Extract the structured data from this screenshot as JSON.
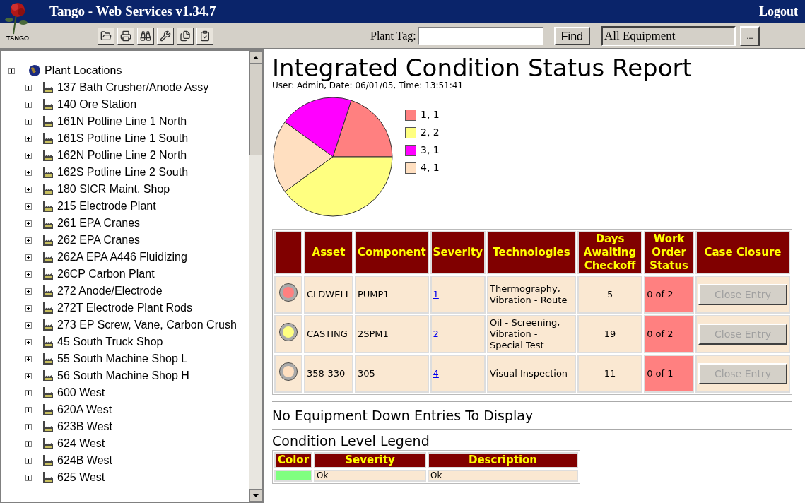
{
  "window": {
    "title": "Tango - Web Services v1.34.7",
    "logout": "Logout"
  },
  "logo": {
    "text": "TANGO"
  },
  "toolbar": {
    "plant_tag_label": "Plant Tag:",
    "find_button": "Find",
    "equipment_field": "All Equipment",
    "browse_button": "..."
  },
  "tree": {
    "root": {
      "label": "Plant Locations",
      "expanded": false,
      "children": [
        {
          "label": "137 Bath Crusher/Anode Assy",
          "expanded": false
        },
        {
          "label": "140 Ore Station",
          "expanded": false
        },
        {
          "label": "161N Potline Line 1 North",
          "expanded": false
        },
        {
          "label": "161S Potline Line 1 South",
          "expanded": false
        },
        {
          "label": "162N Potline Line 2 North",
          "expanded": false
        },
        {
          "label": "162S Potline Line 2 South",
          "expanded": false
        },
        {
          "label": "180 SICR Maint. Shop",
          "expanded": false
        },
        {
          "label": "215 Electrode Plant",
          "expanded": false
        },
        {
          "label": "261 EPA Cranes",
          "expanded": false
        },
        {
          "label": "262 EPA Cranes",
          "expanded": false
        },
        {
          "label": "262A EPA A446 Fluidizing",
          "expanded": false
        },
        {
          "label": "26CP Carbon Plant",
          "expanded": false
        },
        {
          "label": "272 Anode/Electrode",
          "expanded": false
        },
        {
          "label": "272T Electrode Plant Rods",
          "expanded": false
        },
        {
          "label": "273 EP Screw, Vane, Carbon Crush",
          "expanded": false
        },
        {
          "label": "45 South Truck Shop",
          "expanded": false
        },
        {
          "label": "55 South Machine Shop L",
          "expanded": false
        },
        {
          "label": "56 South Machine Shop H",
          "expanded": false
        },
        {
          "label": "600 West",
          "expanded": false
        },
        {
          "label": "620A West",
          "expanded": false
        },
        {
          "label": "623B West",
          "expanded": false
        },
        {
          "label": "624 West",
          "expanded": false
        },
        {
          "label": "624B West",
          "expanded": false
        },
        {
          "label": "625 West",
          "expanded": false
        }
      ]
    }
  },
  "report": {
    "title": "Integrated Condition Status Report",
    "subtitle": "User: Admin, Date: 06/01/05, Time: 13:51:41",
    "chart_data": {
      "type": "pie",
      "categories": [
        "1, 1",
        "2, 2",
        "3, 1",
        "4, 1"
      ],
      "series": [
        {
          "values": [
            1,
            2,
            1,
            1
          ]
        }
      ],
      "colors": [
        "#ff8080",
        "#ffff80",
        "#ff00ff",
        "#ffdfc0"
      ]
    },
    "table": {
      "columns": [
        "",
        "Asset",
        "Component",
        "Severity",
        "Technologies",
        "Days Awaiting Checkoff",
        "Work Order Status",
        "Case Closure"
      ],
      "rows": [
        {
          "color": "#ff8080",
          "asset": "CLDWELL",
          "component": "PUMP1",
          "severity": "1",
          "technologies": "Thermography, Vibration - Route",
          "days": "5",
          "work_order": "0 of 2",
          "action": "Close Entry",
          "disabled": true
        },
        {
          "color": "#ffff80",
          "asset": "CASTING",
          "component": "2SPM1",
          "severity": "2",
          "technologies": "Oil - Screening, Vibration - Special Test",
          "days": "19",
          "work_order": "0 of 2",
          "action": "Close Entry",
          "disabled": true
        },
        {
          "color": "#ffdfc0",
          "asset": "358-330",
          "component": "305",
          "severity": "4",
          "technologies": "Visual Inspection",
          "days": "11",
          "work_order": "0 of 1",
          "action": "Close Entry",
          "disabled": true
        }
      ]
    },
    "equipment_down": "No Equipment Down Entries To Display",
    "legend_title": "Condition Level Legend",
    "legend_table": {
      "columns": [
        "Color",
        "Severity",
        "Description"
      ],
      "rows": [
        {
          "color": "#80ff80",
          "severity": "Ok",
          "description": "Ok"
        }
      ]
    }
  }
}
